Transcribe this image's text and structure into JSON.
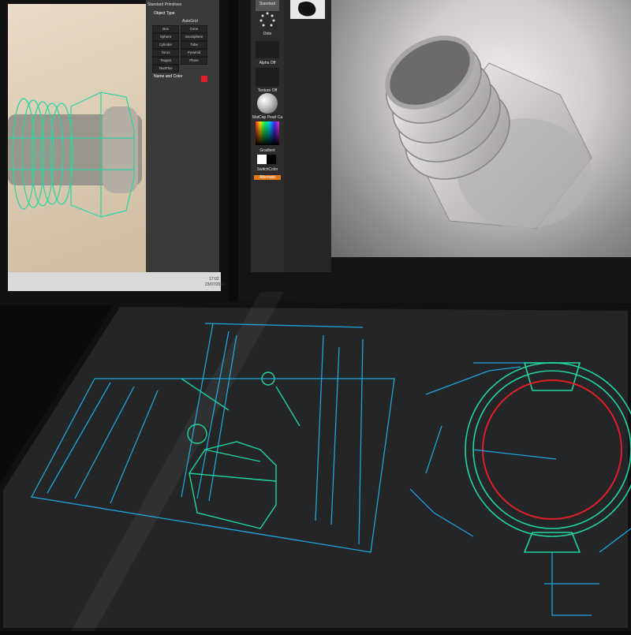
{
  "left_panel": {
    "header": "Standard Primitives",
    "section": "Object Type",
    "autogrid": "AutoGrid",
    "buttons": [
      "Box",
      "Cone",
      "Sphere",
      "GeoSphere",
      "Cylinder",
      "Tube",
      "Torus",
      "Pyramid",
      "Teapot",
      "Plane",
      "TextPlus"
    ],
    "section2": "Name and Color"
  },
  "left_status": {
    "time": "17:02",
    "date": "23/07/2024"
  },
  "zbrush_toolbar": {
    "labels": [
      "Standard",
      "Dots",
      "Alpha Off",
      "Texture Off",
      "MatCap Pearl Ca",
      "Gradient",
      "SwitchColor",
      "Alternate"
    ]
  },
  "colors": {
    "cad_cyan": "#1fa6d8",
    "cad_green": "#20d6a0",
    "cad_red": "#e01f2b",
    "wire_green": "#2bd4a4"
  }
}
